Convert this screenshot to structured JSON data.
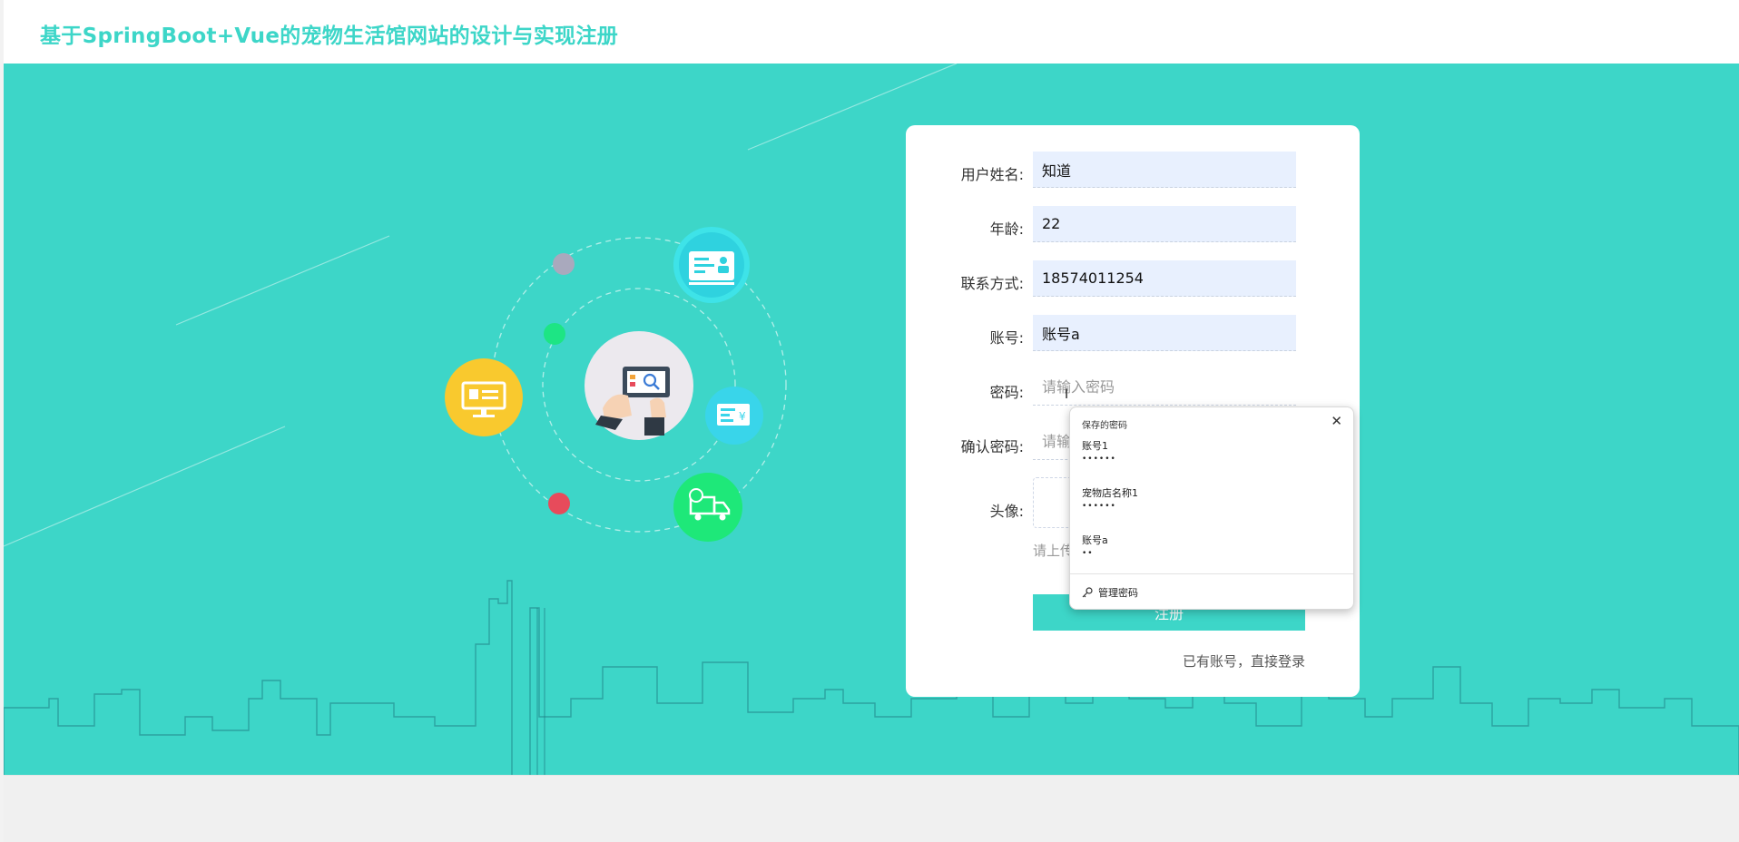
{
  "header": {
    "title": "基于SpringBoot+Vue的宠物生活馆网站的设计与实现注册"
  },
  "form": {
    "fields": [
      {
        "label": "用户姓名:",
        "value": "知道",
        "placeholder": ""
      },
      {
        "label": "年龄:",
        "value": "22",
        "placeholder": ""
      },
      {
        "label": "联系方式:",
        "value": "18574011254",
        "placeholder": ""
      },
      {
        "label": "账号:",
        "value": "账号a",
        "placeholder": ""
      },
      {
        "label": "密码:",
        "value": "",
        "placeholder": "请输入密码"
      },
      {
        "label": "确认密码:",
        "value": "",
        "placeholder": "请输"
      }
    ],
    "avatar_label": "头像:",
    "upload_tip": "请上传",
    "register_button": "注册",
    "login_link": "已有账号，直接登录"
  },
  "password_popup": {
    "title": "保存的密码",
    "entries": [
      {
        "username": "账号1",
        "password_mask": "••••••"
      },
      {
        "username": "宠物店名称1",
        "password_mask": "••••••"
      },
      {
        "username": "账号a",
        "password_mask": "••"
      }
    ],
    "manage_label": "管理密码"
  },
  "colors": {
    "accent": "#3dd6c8",
    "icon_yellow": "#f9c92e",
    "icon_cyan": "#39d5ea",
    "icon_green": "#1ee879",
    "dot_gray": "#a9a9bd",
    "dot_green": "#1de584",
    "dot_red": "#e74b5b"
  },
  "icons": [
    "id-card-icon",
    "monitor-icon",
    "payment-card-icon",
    "delivery-truck-icon",
    "tablet-search-icon",
    "close-icon",
    "key-icon"
  ]
}
